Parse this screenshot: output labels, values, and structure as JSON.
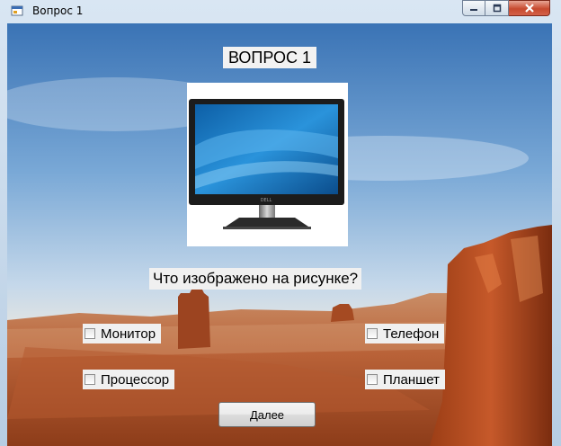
{
  "window": {
    "title": "Вопрос 1",
    "controls": {
      "minimize": "minimize",
      "maximize": "maximize",
      "close": "close"
    }
  },
  "question": {
    "heading": "ВОПРОС 1",
    "image_icon": "monitor-image",
    "text": "Что изображено на рисунке?",
    "options": [
      {
        "label": "Монитор",
        "checked": false
      },
      {
        "label": "Телефон",
        "checked": false
      },
      {
        "label": "Процессор",
        "checked": false
      },
      {
        "label": "Планшет",
        "checked": false
      }
    ]
  },
  "actions": {
    "next_label": "Далее"
  },
  "colors": {
    "title_bg": "#f2f2f2",
    "close_button": "#c74a2f",
    "screen_blue": "#1f7fc8"
  }
}
